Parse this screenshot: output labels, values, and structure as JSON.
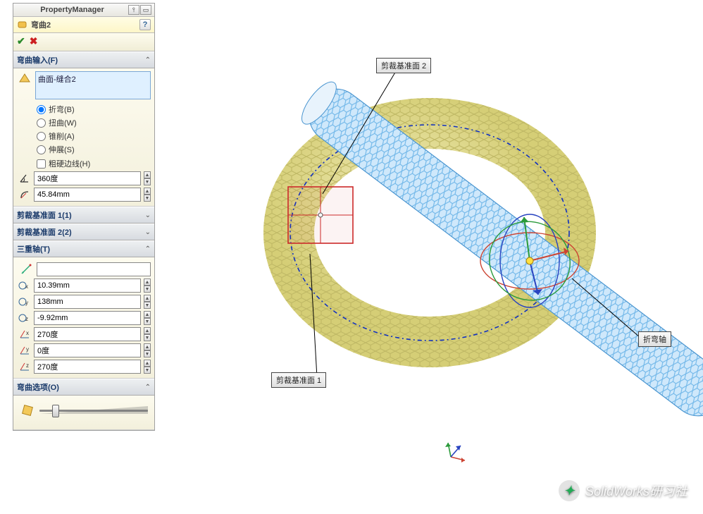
{
  "header": {
    "title": "PropertyManager"
  },
  "feature": {
    "name": "弯曲2"
  },
  "sections": {
    "flex_input": {
      "title": "弯曲输入(F)"
    },
    "trim1": {
      "title": "剪裁基准面 1(1)"
    },
    "trim2": {
      "title": "剪裁基准面 2(2)"
    },
    "triad": {
      "title": "三重轴(T)"
    },
    "options": {
      "title": "弯曲选项(O)"
    }
  },
  "selection": {
    "item": "曲面-缝合2"
  },
  "radios": {
    "bend": "折弯(B)",
    "twist": "扭曲(W)",
    "taper": "锥削(A)",
    "stretch": "伸展(S)"
  },
  "checkbox": {
    "hard_edges": "粗硬边线(H)"
  },
  "values": {
    "angle": "360度",
    "radius": "45.84mm",
    "tx": "10.39mm",
    "ty": "138mm",
    "tz": "-9.92mm",
    "rx": "270度",
    "ry": "0度",
    "rz": "270度"
  },
  "callouts": {
    "trim_plane_2": "剪裁基准面 2",
    "trim_plane_1": "剪裁基准面 1",
    "bend_axis": "折弯轴"
  },
  "watermark": {
    "text": "SolidWorks研习社"
  }
}
